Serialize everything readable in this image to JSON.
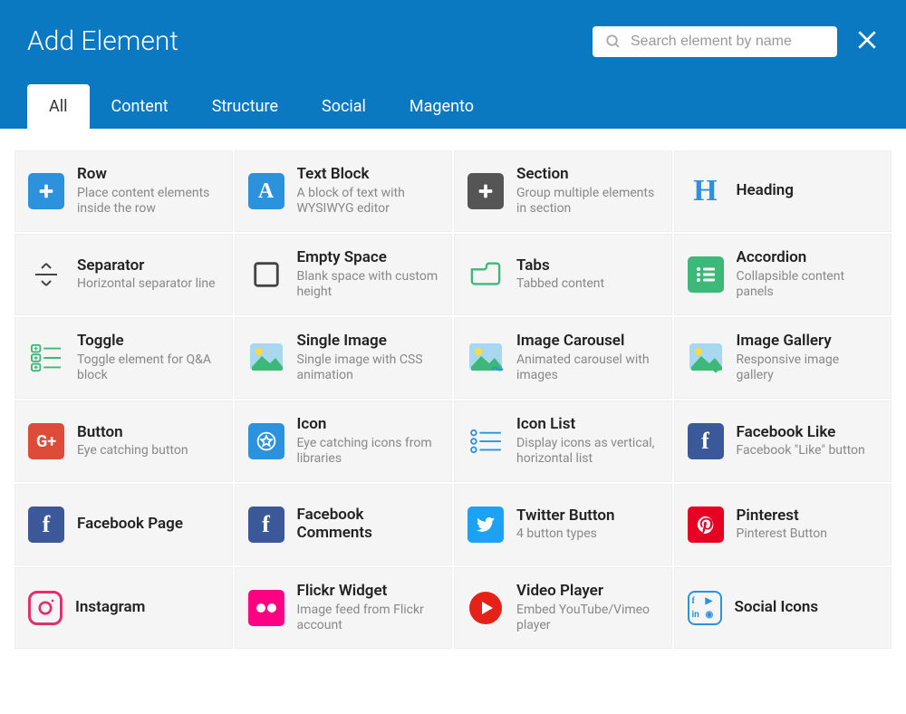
{
  "header": {
    "title": "Add Element",
    "search_placeholder": "Search element by name"
  },
  "tabs": [
    {
      "label": "All",
      "active": true
    },
    {
      "label": "Content",
      "active": false
    },
    {
      "label": "Structure",
      "active": false
    },
    {
      "label": "Social",
      "active": false
    },
    {
      "label": "Magento",
      "active": false
    }
  ],
  "elements": [
    {
      "name": "Row",
      "desc": "Place content elements inside the row",
      "icon": "plus-blue"
    },
    {
      "name": "Text Block",
      "desc": "A block of text with WYSIWYG editor",
      "icon": "letter-a"
    },
    {
      "name": "Section",
      "desc": "Group multiple elements in section",
      "icon": "plus-dark"
    },
    {
      "name": "Heading",
      "desc": "",
      "icon": "heading-h"
    },
    {
      "name": "Separator",
      "desc": "Horizontal separator line",
      "icon": "separator"
    },
    {
      "name": "Empty Space",
      "desc": "Blank space with custom height",
      "icon": "empty-square"
    },
    {
      "name": "Tabs",
      "desc": "Tabbed content",
      "icon": "tabs"
    },
    {
      "name": "Accordion",
      "desc": "Collapsible content panels",
      "icon": "accordion"
    },
    {
      "name": "Toggle",
      "desc": "Toggle element for Q&A block",
      "icon": "toggle"
    },
    {
      "name": "Single Image",
      "desc": "Single image with CSS animation",
      "icon": "image"
    },
    {
      "name": "Image Carousel",
      "desc": "Animated carousel with images",
      "icon": "image-wave"
    },
    {
      "name": "Image Gallery",
      "desc": "Responsive image gallery",
      "icon": "image-check"
    },
    {
      "name": "Button",
      "desc": "Eye catching button",
      "icon": "gplus"
    },
    {
      "name": "Icon",
      "desc": "Eye catching icons from libraries",
      "icon": "star-circle"
    },
    {
      "name": "Icon List",
      "desc": "Display icons as vertical, horizontal list",
      "icon": "icon-list"
    },
    {
      "name": "Facebook Like",
      "desc": "Facebook \"Like\" button",
      "icon": "facebook"
    },
    {
      "name": "Facebook Page",
      "desc": "",
      "icon": "facebook"
    },
    {
      "name": "Facebook Comments",
      "desc": "",
      "icon": "facebook"
    },
    {
      "name": "Twitter Button",
      "desc": "4 button types",
      "icon": "twitter"
    },
    {
      "name": "Pinterest",
      "desc": "Pinterest Button",
      "icon": "pinterest"
    },
    {
      "name": "Instagram",
      "desc": "",
      "icon": "instagram"
    },
    {
      "name": "Flickr Widget",
      "desc": "Image feed from Flickr account",
      "icon": "flickr"
    },
    {
      "name": "Video Player",
      "desc": "Embed YouTube/Vimeo player",
      "icon": "video"
    },
    {
      "name": "Social Icons",
      "desc": "",
      "icon": "social-grid"
    }
  ]
}
